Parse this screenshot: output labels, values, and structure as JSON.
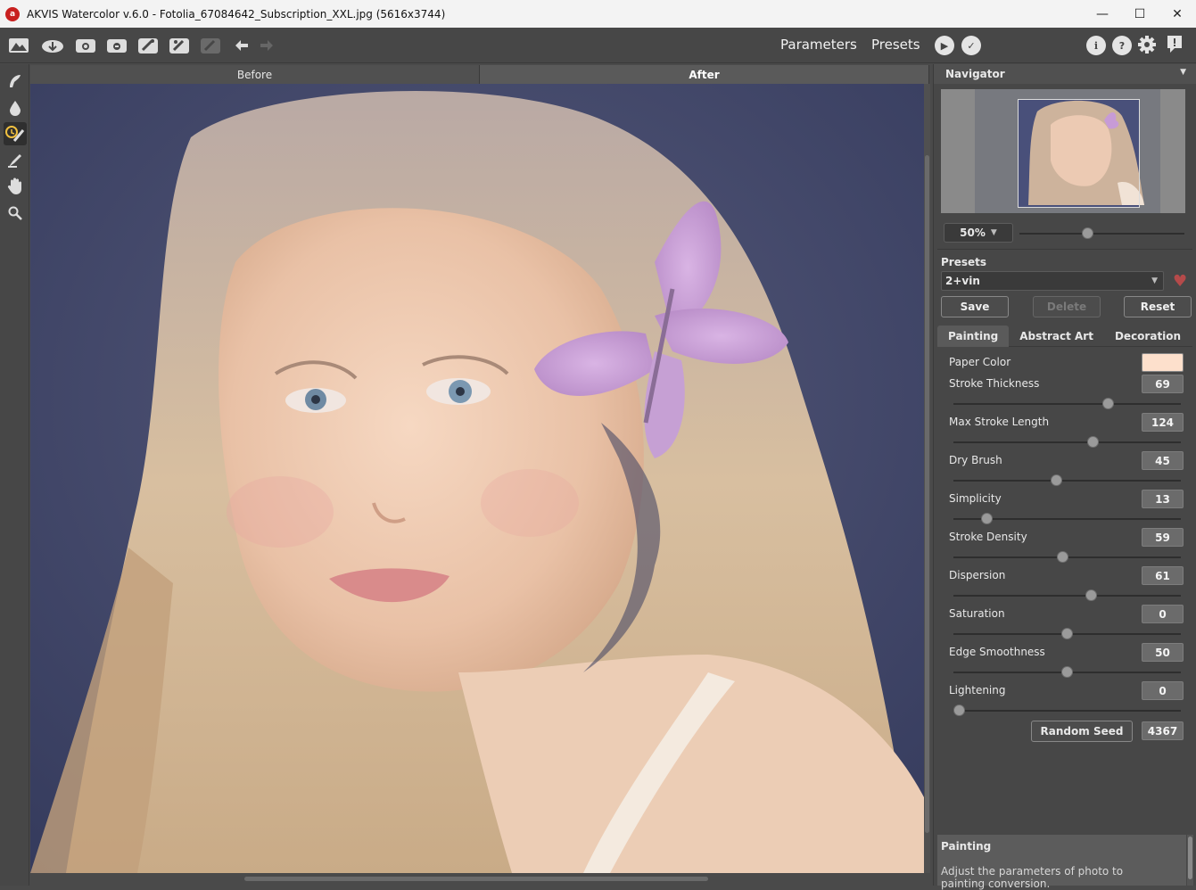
{
  "window": {
    "title": "AKVIS Watercolor v.6.0 - Fotolia_67084642_Subscription_XXL.jpg (5616x3744)",
    "app_icon_letter": "a",
    "minimize": "—",
    "maximize": "☐",
    "close": "✕"
  },
  "toolbar": {
    "parameters_label": "Parameters",
    "presets_label": "Presets",
    "run_label": "▶",
    "apply_label": "✓",
    "info_label": "i",
    "help_label": "?",
    "settings_icon": "gear-icon",
    "notify_label": "!"
  },
  "canvas": {
    "tabs": [
      "Before",
      "After"
    ],
    "active_tab": "After"
  },
  "navigator": {
    "title": "Navigator",
    "zoom_value": "50%",
    "zoom_slider_fraction": 0.4
  },
  "presets": {
    "label": "Presets",
    "selected": "2+vin",
    "save_label": "Save",
    "delete_label": "Delete",
    "reset_label": "Reset"
  },
  "tabs": {
    "painting": "Painting",
    "abstract_art": "Abstract Art",
    "decoration": "Decoration"
  },
  "params": {
    "paper_color_label": "Paper Color",
    "paper_color": "#fde0cc",
    "items": [
      {
        "label": "Stroke Thickness",
        "value": "69",
        "fraction": 0.69
      },
      {
        "label": "Max Stroke Length",
        "value": "124",
        "fraction": 0.62
      },
      {
        "label": "Dry Brush",
        "value": "45",
        "fraction": 0.45
      },
      {
        "label": "Simplicity",
        "value": "13",
        "fraction": 0.13
      },
      {
        "label": "Stroke Density",
        "value": "59",
        "fraction": 0.48
      },
      {
        "label": "Dispersion",
        "value": "61",
        "fraction": 0.61
      },
      {
        "label": "Saturation",
        "value": "0",
        "fraction": 0.5
      },
      {
        "label": "Edge Smoothness",
        "value": "50",
        "fraction": 0.5
      },
      {
        "label": "Lightening",
        "value": "0",
        "fraction": 0.0
      }
    ],
    "random_seed_label": "Random Seed",
    "random_seed_value": "4367"
  },
  "help": {
    "title": "Painting",
    "text": "Adjust the parameters of photo to painting conversion."
  },
  "colors": {
    "panel_bg": "#474747",
    "canvas_bg": "#3c4363",
    "accent_heart": "#b54a4a"
  }
}
